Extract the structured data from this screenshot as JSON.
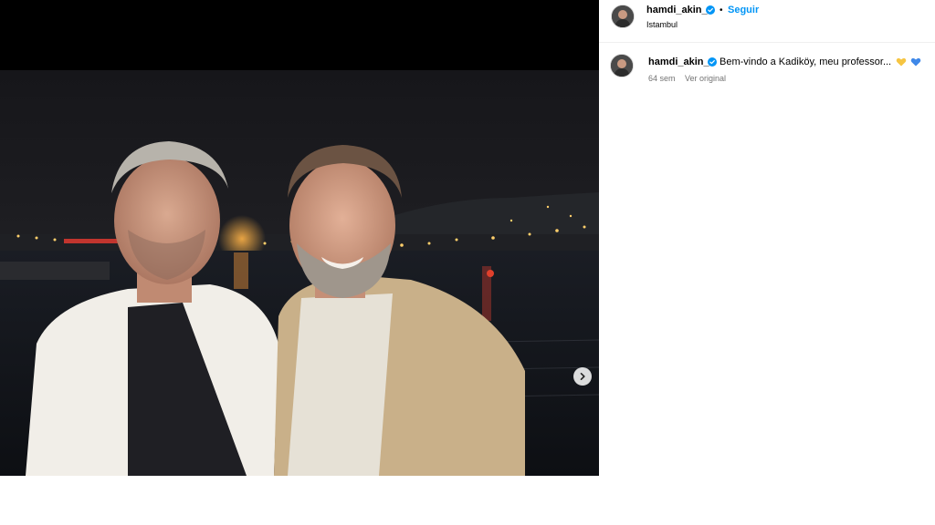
{
  "post": {
    "author": "hamdi_akin_",
    "follow_label": "Seguir",
    "separator": "•",
    "location": "Istambul"
  },
  "caption": {
    "author": "hamdi_akin_",
    "text": "Bem-vindo a Kadiköy, meu professor...",
    "emojis": [
      "yellow-heart-icon",
      "blue-heart-icon"
    ],
    "time": "64 sem",
    "see_original": "Ver original"
  },
  "colors": {
    "link_blue": "#0095f6",
    "verified_blue": "#0095f6",
    "muted_text": "#737373",
    "yellow_heart": "#f6c542",
    "blue_heart": "#3f88e8"
  }
}
